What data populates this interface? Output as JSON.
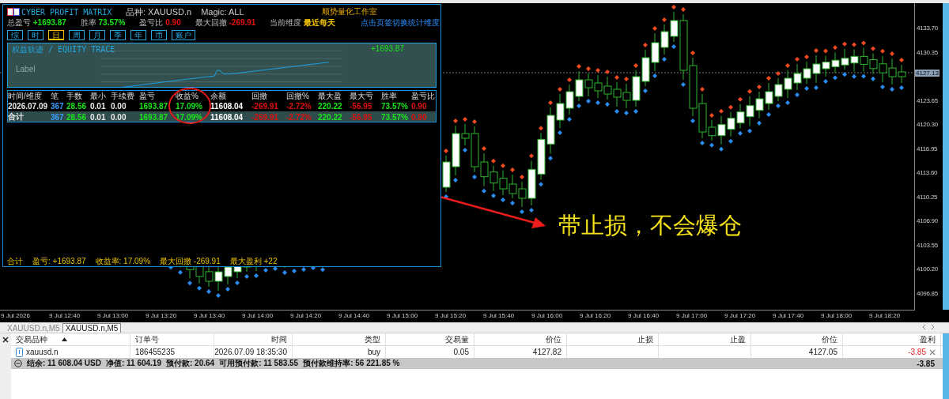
{
  "panel": {
    "title": "CYBER PROFIT MATRIX",
    "symbol": "品种: XAUUSD.n",
    "magic": "Magic: ALL",
    "studio": "顺势量化工作室",
    "stats": [
      {
        "label": "总盈亏",
        "value": "+1693.87",
        "color": "#19e619"
      },
      {
        "label": "胜率",
        "value": "73.57%",
        "color": "#19e619"
      },
      {
        "label": "盈亏比",
        "value": "0.90",
        "color": "#e01010"
      },
      {
        "label": "最大回撤",
        "value": "-269.91",
        "color": "#e01010"
      },
      {
        "label": "当前维度",
        "value": "最近每天",
        "color": "#f2c200"
      }
    ],
    "hint": "点击页签切换统计维度",
    "tabs": [
      {
        "label": "综",
        "selected": false
      },
      {
        "label": "时",
        "selected": false
      },
      {
        "label": "日",
        "selected": true
      },
      {
        "label": "周",
        "selected": false
      },
      {
        "label": "月",
        "selected": false
      },
      {
        "label": "季",
        "selected": false
      },
      {
        "label": "年",
        "selected": false
      },
      {
        "label": "币",
        "selected": false
      },
      {
        "label": "账户",
        "selected": false
      }
    ],
    "equity": {
      "title": "权益轨迹 / EQUITY TRACE",
      "value": "+1693.87",
      "label": "Label"
    },
    "table": {
      "columns": [
        {
          "label": "时间/维度",
          "color": "#e8e8e8"
        },
        {
          "label": "笔",
          "color": "#3a9cff"
        },
        {
          "label": "手数",
          "color": "#19e619"
        },
        {
          "label": "最小",
          "color": "#e8e8e8"
        },
        {
          "label": "手续费",
          "color": "#e8e8e8"
        },
        {
          "label": "盈亏",
          "color": "#19e619"
        },
        {
          "label": "收益%",
          "color": "#19e619"
        },
        {
          "label": "余额"
        },
        {
          "label": "回撤",
          "color": "#e01010"
        },
        {
          "label": "回撤%",
          "color": "#e01010"
        },
        {
          "label": "最大盈",
          "color": "#19e619"
        },
        {
          "label": "最大亏",
          "color": "#e01010"
        },
        {
          "label": "胜率",
          "color": "#19e619"
        },
        {
          "label": "盈亏比",
          "color": "#e01010"
        }
      ],
      "rows": [
        {
          "kind": "data",
          "cells": [
            "2026.07.09",
            "367",
            "28.56",
            "0.01",
            "0.00",
            "1693.87",
            "17.09%",
            "11608.04",
            "-269.91",
            "-2.72%",
            "220.22",
            "-56.95",
            "73.57%",
            "0.90"
          ]
        },
        {
          "kind": "total",
          "cells": [
            "合计",
            "367",
            "28.56",
            "0.01",
            "0.00",
            "1693.87",
            "17.09%",
            "11608.04",
            "-269.91",
            "-2.72%",
            "220.22",
            "-56.95",
            "73.57%",
            "0.90"
          ]
        }
      ]
    },
    "footer": [
      "合计",
      "盈亏: +1693.87",
      "收益率: 17.09%",
      "最大回撤 -269.91",
      "最大盈利 +22"
    ]
  },
  "annotation": "带止损，不会爆仓",
  "price_axis": [
    "4133.70",
    "4130.35",
    "4123.65",
    "4120.30",
    "4116.95",
    "4113.60",
    "4110.25",
    "4106.90",
    "4103.55",
    "4100.20",
    "4096.85"
  ],
  "current_price": "4127.13",
  "time_axis": [
    "9 Jul 2026",
    "9 Jul 12:40",
    "9 Jul 13:00",
    "9 Jul 13:20",
    "9 Jul 13:40",
    "9 Jul 14:00",
    "9 Jul 14:20",
    "9 Jul 14:40",
    "9 Jul 15:00",
    "9 Jul 15:20",
    "9 Jul 15:40",
    "9 Jul 16:00",
    "9 Jul 16:20",
    "9 Jul 16:40",
    "9 Jul 17:00",
    "9 Jul 17:20",
    "9 Jul 17:40",
    "9 Jul 18:00",
    "9 Jul 18:20"
  ],
  "chart_tabs": [
    {
      "label": "XAUUSD.n,M5",
      "selected": false
    },
    {
      "label": "XAUUSD.n,M5",
      "selected": true
    }
  ],
  "orders": {
    "columns": [
      "交易品种",
      "订单号",
      "时间",
      "类型",
      "交易量",
      "价位",
      "止损",
      "止盈",
      "价位",
      "盈利"
    ],
    "rows": [
      {
        "cells": [
          "xauusd.n",
          "186455235",
          "2026.07.09 18:35:30",
          "buy",
          "0.05",
          "4127.82",
          "",
          "",
          "4127.05",
          "-3.85"
        ]
      }
    ],
    "summary": [
      "结余: 11 608.04 USD",
      "净值: 11 604.19",
      "预付款: 20.64",
      "可用预付款: 11 583.55",
      "预付款维持率: 56 221.85 %"
    ],
    "total": "-3.85"
  }
}
